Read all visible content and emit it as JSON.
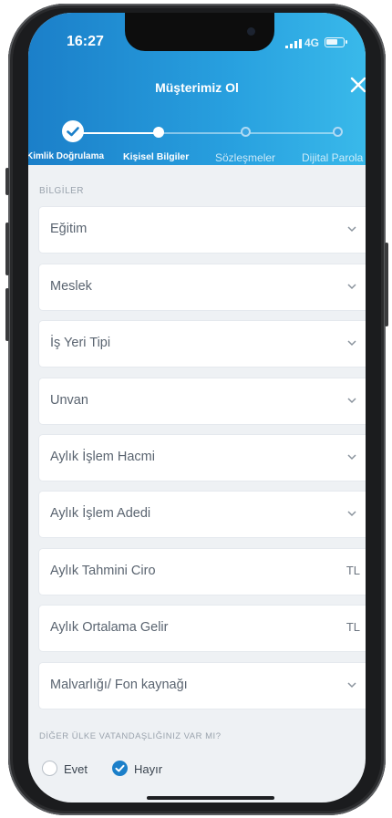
{
  "status_bar": {
    "time": "16:27",
    "network": "4G"
  },
  "header": {
    "title": "Müşterimiz Ol"
  },
  "steps": [
    {
      "label": "Kimlik Doğrulama",
      "state": "done"
    },
    {
      "label": "Kişisel Bilgiler",
      "state": "current"
    },
    {
      "label": "Sözleşmeler",
      "state": "pending"
    },
    {
      "label": "Dijital Parola",
      "state": "pending"
    }
  ],
  "section_info": "BİLGİLER",
  "fields": [
    {
      "label": "Eğitim",
      "type": "select"
    },
    {
      "label": "Meslek",
      "type": "select"
    },
    {
      "label": "İş Yeri Tipi",
      "type": "select"
    },
    {
      "label": "Unvan",
      "type": "select"
    },
    {
      "label": "Aylık İşlem Hacmi",
      "type": "select"
    },
    {
      "label": "Aylık İşlem Adedi",
      "type": "select"
    },
    {
      "label": "Aylık Tahmini Ciro",
      "type": "input",
      "suffix": "TL"
    },
    {
      "label": "Aylık Ortalama Gelir",
      "type": "input",
      "suffix": "TL"
    },
    {
      "label": "Malvarlığı/ Fon kaynağı",
      "type": "select"
    }
  ],
  "question": "DİĞER ÜLKE VATANDAŞLIĞINIZ VAR MI?",
  "options": [
    {
      "label": "Evet",
      "selected": false
    },
    {
      "label": "Hayır",
      "selected": true
    }
  ],
  "colors": {
    "primary": "#1b7fc9",
    "header_end": "#39b9ea",
    "background": "#eef1f4"
  }
}
